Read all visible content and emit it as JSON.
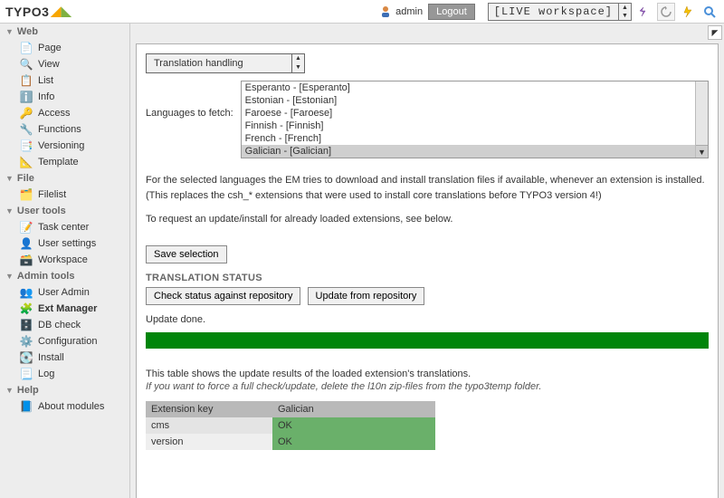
{
  "brand": "TYPO3",
  "topbar": {
    "username": "admin",
    "logout": "Logout",
    "workspace": "[LIVE workspace]"
  },
  "sidebar": {
    "groups": [
      {
        "label": "Web",
        "items": [
          {
            "label": "Page"
          },
          {
            "label": "View"
          },
          {
            "label": "List"
          },
          {
            "label": "Info"
          },
          {
            "label": "Access"
          },
          {
            "label": "Functions"
          },
          {
            "label": "Versioning"
          },
          {
            "label": "Template"
          }
        ]
      },
      {
        "label": "File",
        "items": [
          {
            "label": "Filelist"
          }
        ]
      },
      {
        "label": "User tools",
        "items": [
          {
            "label": "Task center"
          },
          {
            "label": "User settings"
          },
          {
            "label": "Workspace"
          }
        ]
      },
      {
        "label": "Admin tools",
        "items": [
          {
            "label": "User Admin"
          },
          {
            "label": "Ext Manager",
            "active": true
          },
          {
            "label": "DB check"
          },
          {
            "label": "Configuration"
          },
          {
            "label": "Install"
          },
          {
            "label": "Log"
          }
        ]
      },
      {
        "label": "Help",
        "items": [
          {
            "label": "About modules"
          }
        ]
      }
    ]
  },
  "main": {
    "action_select": "Translation handling",
    "lang_label": "Languages to fetch:",
    "lang_options": [
      "Esperanto - [Esperanto]",
      "Estonian - [Estonian]",
      "Faroese - [Faroese]",
      "Finnish - [Finnish]",
      "French - [French]",
      "Galician - [Galician]"
    ],
    "lang_selected_index": 5,
    "desc1": "For the selected languages the EM tries to download and install translation files if available, whenever an extension is installed. (This replaces the csh_* extensions that were used to install core translations before TYPO3 version 4!)",
    "desc2": "To request an update/install for already loaded extensions, see below.",
    "save_btn": "Save selection",
    "status_heading": "TRANSLATION STATUS",
    "check_btn": "Check status against repository",
    "update_btn": "Update from repository",
    "update_done": "Update done.",
    "result_intro": "This table shows the update results of the loaded extension's translations.",
    "result_hint": "If you want to force a full check/update, delete the l10n zip-files from the typo3temp folder.",
    "table": {
      "headers": [
        "Extension key",
        "Galician"
      ],
      "rows": [
        {
          "k": "cms",
          "v": "OK"
        },
        {
          "k": "version",
          "v": "OK"
        }
      ]
    }
  }
}
